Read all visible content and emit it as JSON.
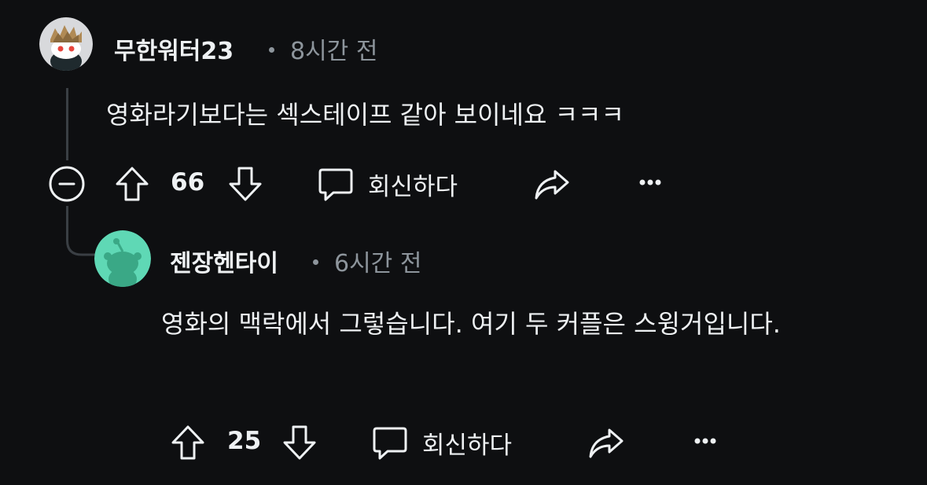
{
  "comments": [
    {
      "username": "무한워터23",
      "time": "8시간 전",
      "text": "영화라기보다는 섹스테이프 같아 보이네요 ㅋㅋㅋ",
      "votes": "66",
      "reply_label": "회신하다"
    },
    {
      "username": "젠장헨타이",
      "time": "6시간 전",
      "text": "영화의 맥락에서 그렇습니다. 여기 두 커플은 스윙거입니다.",
      "votes": "25",
      "reply_label": "회신하다"
    }
  ],
  "colors": {
    "background": "#0e0f11",
    "text": "#eef1f3",
    "muted": "#8d959c",
    "thread_line": "#3a3f44",
    "avatar2_bg": "#5fd8b5"
  }
}
